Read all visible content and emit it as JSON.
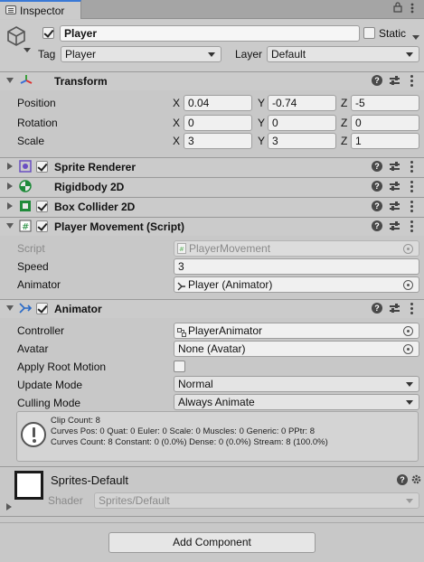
{
  "tab": {
    "label": "Inspector"
  },
  "header": {
    "object_name": "Player",
    "static_label": "Static",
    "tag_label": "Tag",
    "tag_value": "Player",
    "layer_label": "Layer",
    "layer_value": "Default"
  },
  "transform": {
    "title": "Transform",
    "rows": [
      {
        "label": "Position",
        "x": "0.04",
        "y": "-0.74",
        "z": "-5"
      },
      {
        "label": "Rotation",
        "x": "0",
        "y": "0",
        "z": "0"
      },
      {
        "label": "Scale",
        "x": "3",
        "y": "3",
        "z": "1"
      }
    ],
    "axis": {
      "x": "X",
      "y": "Y",
      "z": "Z"
    }
  },
  "components": {
    "sprite_renderer": "Sprite Renderer",
    "rigidbody": "Rigidbody 2D",
    "box_collider": "Box Collider 2D",
    "player_movement": "Player Movement (Script)",
    "animator": "Animator"
  },
  "player_movement": {
    "script_label": "Script",
    "script_value": "PlayerMovement",
    "speed_label": "Speed",
    "speed_value": "3",
    "animator_label": "Animator",
    "animator_value": "Player (Animator)"
  },
  "animator": {
    "controller_label": "Controller",
    "controller_value": "PlayerAnimator",
    "avatar_label": "Avatar",
    "avatar_value": "None (Avatar)",
    "apply_root_label": "Apply Root Motion",
    "apply_root_value": false,
    "update_mode_label": "Update Mode",
    "update_mode_value": "Normal",
    "culling_mode_label": "Culling Mode",
    "culling_mode_value": "Always Animate",
    "info_lines": [
      "Clip Count: 8",
      "Curves Pos: 0 Quat: 0 Euler: 0 Scale: 0 Muscles: 0 Generic: 0 PPtr: 8",
      "Curves Count: 8 Constant: 0 (0.0%) Dense: 0 (0.0%) Stream: 8 (100.0%)"
    ]
  },
  "material": {
    "name": "Sprites-Default",
    "shader_label": "Shader",
    "shader_value": "Sprites/Default"
  },
  "add_component_label": "Add Component",
  "colors": {
    "accent": "#3a79d6",
    "panel": "#c8c8c8",
    "header": "#cbcbcb"
  }
}
